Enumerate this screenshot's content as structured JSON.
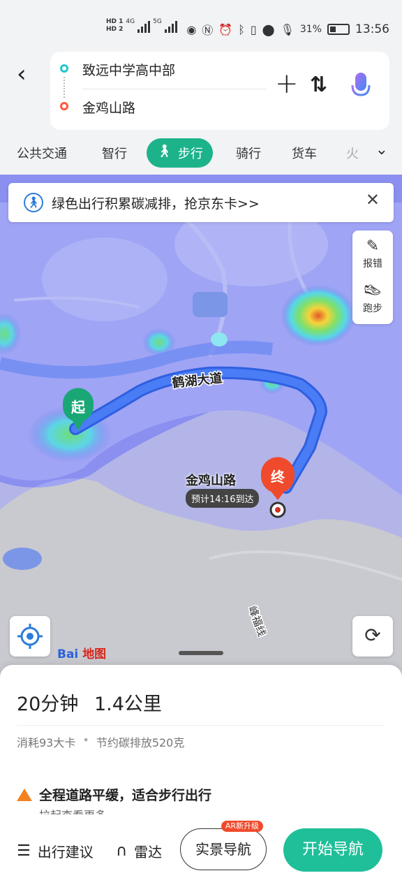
{
  "status_bar": {
    "hd1": "HD 1",
    "hd2": "HD 2",
    "net1": "4G",
    "net2": "5G",
    "battery_pct": "31%",
    "time": "13:56"
  },
  "route": {
    "back_icon": "back-arrow-icon",
    "from": "致远中学高中部",
    "to": "金鸡山路",
    "add_icon": "plus-icon",
    "swap_icon": "swap-icon",
    "voice_icon": "microphone-icon"
  },
  "modes": {
    "items": [
      "公共交通",
      "智行",
      "步行",
      "骑行",
      "货车",
      "火"
    ],
    "active_index": 2,
    "more_icon": "chevron-down-icon"
  },
  "map": {
    "banner_text": "绿色出行积累碳减排，抢京东卡>>",
    "tools": [
      {
        "label": "报错",
        "icon": "edit-icon"
      },
      {
        "label": "跑步",
        "icon": "running-shoe-icon"
      }
    ],
    "road_label": "鹤湖大道",
    "dest_label": "金鸡山路",
    "side_road_label": "峰福线",
    "start_marker": "起",
    "end_marker": "终",
    "eta": "预计14:16到达",
    "logo_text": "Bai",
    "logo_text2": "地图"
  },
  "summary": {
    "duration": "20分钟",
    "distance": "1.4公里",
    "calories": "消耗93大卡",
    "carbon": "节约碳排放520克",
    "tip": "全程道路平缓，适合步行出行",
    "pull_more": "拉起查看更多"
  },
  "actions": {
    "advice": "出行建议",
    "radar": "雷达",
    "ar_nav": "实景导航",
    "ar_badge": "AR新升级",
    "start_nav": "开始导航"
  },
  "colors": {
    "accent": "#1db38a",
    "route": "#3a6cf0",
    "start": "#19a97a",
    "end": "#f04a2c"
  }
}
